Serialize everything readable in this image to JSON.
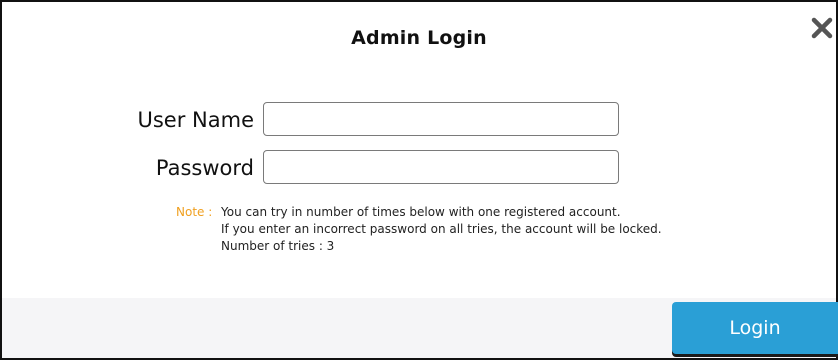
{
  "dialog": {
    "title": "Admin Login",
    "close_icon": "close-icon"
  },
  "form": {
    "username_label": "User Name",
    "username_value": "",
    "password_label": "Password",
    "password_value": ""
  },
  "note": {
    "label": "Note :",
    "line1": "You can try in number of times below with one registered account.",
    "line2": "If you enter an incorrect password on all tries, the account will be locked.",
    "line3": "Number of tries : 3"
  },
  "footer": {
    "login_label": "Login"
  },
  "colors": {
    "accent": "#2a9fd6",
    "note_label": "#f0a020",
    "footer_bg": "#f5f5f7"
  }
}
